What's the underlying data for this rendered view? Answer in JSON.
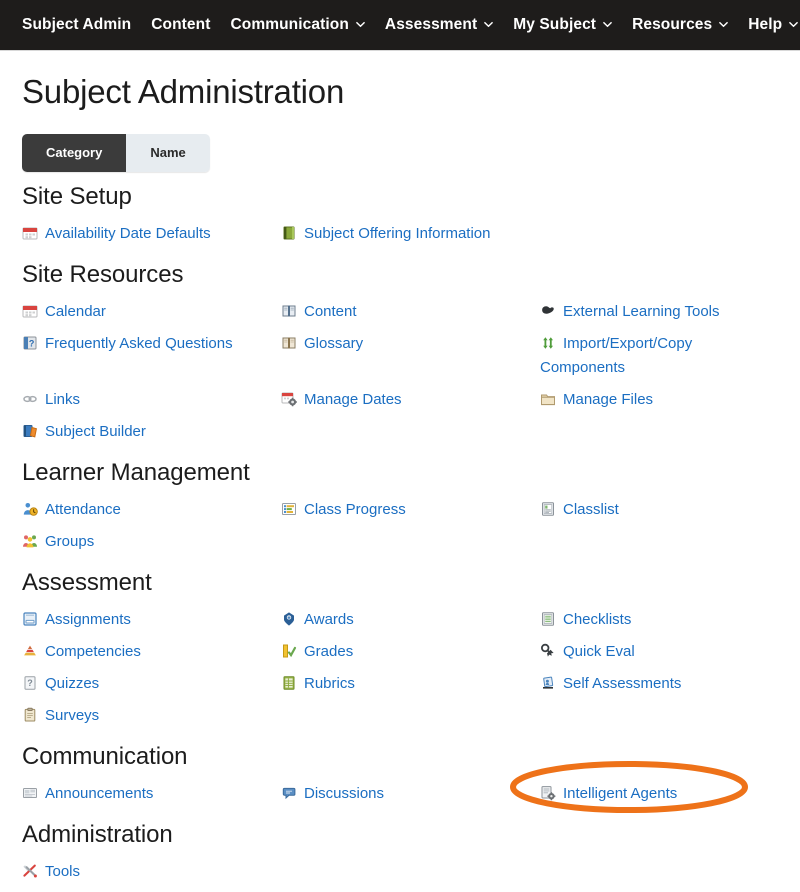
{
  "navbar": {
    "items": [
      {
        "label": "Subject Admin",
        "has_caret": false
      },
      {
        "label": "Content",
        "has_caret": false
      },
      {
        "label": "Communication",
        "has_caret": true
      },
      {
        "label": "Assessment",
        "has_caret": true
      },
      {
        "label": "My Subject",
        "has_caret": true
      },
      {
        "label": "Resources",
        "has_caret": true
      },
      {
        "label": "Help",
        "has_caret": true
      }
    ]
  },
  "page": {
    "title": "Subject Administration"
  },
  "view_toggle": {
    "options": [
      {
        "label": "Category",
        "active": true
      },
      {
        "label": "Name",
        "active": false
      }
    ]
  },
  "colors": {
    "link": "#1b6ec2",
    "navbar_bg": "#1e1c1b",
    "toggle_active_bg": "#3b3b3b",
    "toggle_inactive_bg": "#e7ecf0",
    "highlight": "#ee7219"
  },
  "highlight": {
    "target": "Intelligent Agents",
    "shape": "ellipse",
    "color": "#ee7219"
  },
  "sections": [
    {
      "heading": "Site Setup",
      "items": [
        {
          "label": "Availability Date Defaults",
          "icon": "calendar-red-icon",
          "col": 0
        },
        {
          "label": "Subject Offering Information",
          "icon": "green-book-icon",
          "col": 1
        }
      ]
    },
    {
      "heading": "Site Resources",
      "items": [
        {
          "label": "Calendar",
          "icon": "calendar-red-icon",
          "col": 0
        },
        {
          "label": "Content",
          "icon": "open-book-blue-icon",
          "col": 1
        },
        {
          "label": "External Learning Tools",
          "icon": "puzzle-dark-icon",
          "col": 2
        },
        {
          "label": "Frequently Asked Questions",
          "icon": "question-box-icon",
          "col": 0
        },
        {
          "label": "Glossary",
          "icon": "open-book-tan-icon",
          "col": 1
        },
        {
          "label": "Import/Export/Copy Components",
          "icon": "green-arrows-icon",
          "col": 2
        },
        {
          "label": "Links",
          "icon": "chain-link-icon",
          "col": 0
        },
        {
          "label": "Manage Dates",
          "icon": "calendar-gear-icon",
          "col": 1
        },
        {
          "label": "Manage Files",
          "icon": "folder-tan-icon",
          "col": 2
        },
        {
          "label": "Subject Builder",
          "icon": "books-stack-icon",
          "col": 0
        }
      ]
    },
    {
      "heading": "Learner Management",
      "items": [
        {
          "label": "Attendance",
          "icon": "person-clock-icon",
          "col": 0
        },
        {
          "label": "Class Progress",
          "icon": "progress-bars-icon",
          "col": 1
        },
        {
          "label": "Classlist",
          "icon": "classlist-icon",
          "col": 2
        },
        {
          "label": "Groups",
          "icon": "groups-people-icon",
          "col": 0
        }
      ]
    },
    {
      "heading": "Assessment",
      "items": [
        {
          "label": "Assignments",
          "icon": "assignment-tray-icon",
          "col": 0
        },
        {
          "label": "Awards",
          "icon": "award-ribbon-icon",
          "col": 1
        },
        {
          "label": "Checklists",
          "icon": "checklist-grid-icon",
          "col": 2
        },
        {
          "label": "Competencies",
          "icon": "competency-pyramid-icon",
          "col": 0
        },
        {
          "label": "Grades",
          "icon": "grades-check-icon",
          "col": 1
        },
        {
          "label": "Quick Eval",
          "icon": "quick-eval-icon",
          "col": 2
        },
        {
          "label": "Quizzes",
          "icon": "quiz-question-icon",
          "col": 0
        },
        {
          "label": "Rubrics",
          "icon": "rubrics-grid-icon",
          "col": 1
        },
        {
          "label": "Self Assessments",
          "icon": "self-assessment-icon",
          "col": 2
        },
        {
          "label": "Surveys",
          "icon": "survey-clipboard-icon",
          "col": 0
        }
      ]
    },
    {
      "heading": "Communication",
      "items": [
        {
          "label": "Announcements",
          "icon": "announcement-icon",
          "col": 0
        },
        {
          "label": "Discussions",
          "icon": "discussion-bubble-icon",
          "col": 1
        },
        {
          "label": "Intelligent Agents",
          "icon": "intelligent-agent-icon",
          "col": 2
        }
      ]
    },
    {
      "heading": "Administration",
      "items": [
        {
          "label": "Tools",
          "icon": "tools-wrench-icon",
          "col": 0
        }
      ]
    }
  ]
}
